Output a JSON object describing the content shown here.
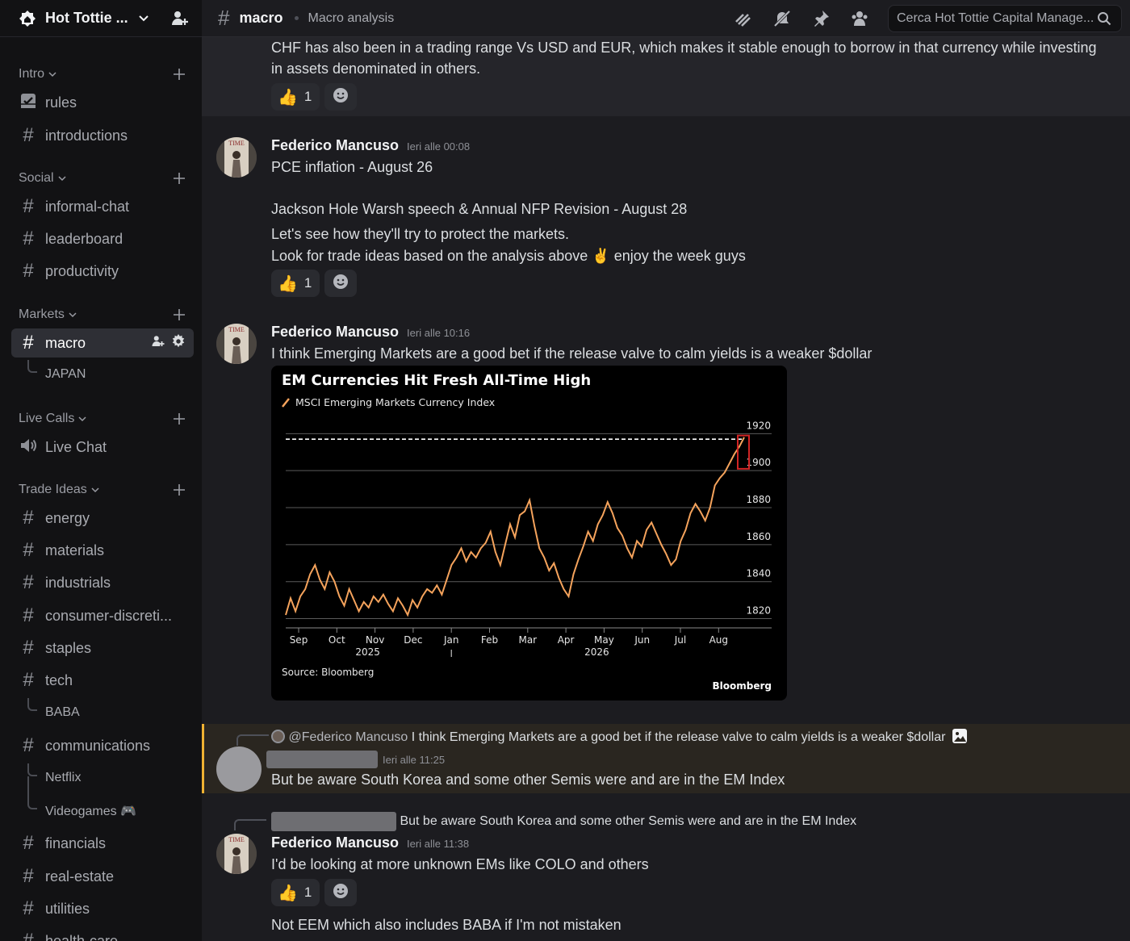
{
  "server": {
    "name": "Hot Tottie ...",
    "icons": {
      "home": "server-home-icon",
      "invite": "invite-people-icon"
    }
  },
  "sidebar": {
    "categories": [
      {
        "label": "Intro"
      },
      {
        "label": "Social"
      },
      {
        "label": "Markets"
      },
      {
        "label": "Live Calls"
      },
      {
        "label": "Trade Ideas"
      }
    ],
    "channels": {
      "rules": "rules",
      "introductions": "introductions",
      "informal_chat": "informal-chat",
      "leaderboard": "leaderboard",
      "productivity": "productivity",
      "macro": "macro",
      "japan": "JAPAN",
      "live_chat": "Live Chat",
      "energy": "energy",
      "materials": "materials",
      "industrials": "industrials",
      "consumer": "consumer-discreti...",
      "staples": "staples",
      "tech": "tech",
      "baba": "BABA",
      "communications": "communications",
      "netflix": "Netflix",
      "videogames": "Videogames 🎮",
      "financials": "financials",
      "real_estate": "real-estate",
      "utilities": "utilities",
      "health_care": "health-care"
    }
  },
  "header": {
    "channel": "macro",
    "topic": "Macro analysis",
    "search_placeholder": "Cerca Hot Tottie Capital Manage..."
  },
  "messages": {
    "m0": {
      "line1": "CHF has also been in a trading range Vs USD and EUR, which makes it stable enough to borrow in that currency while investing",
      "line2": "in assets denominated in others.",
      "reaction": {
        "emoji": "👍",
        "count": "1"
      }
    },
    "m1": {
      "author": "Federico Mancuso",
      "time": "Ieri alle 00:08",
      "line1": "PCE inflation - August 26",
      "line2": "Jackson Hole Warsh speech & Annual NFP Revision - August 28",
      "line3": "Let's see how they'll try to protect the markets.",
      "line4a": "Look for trade ideas based on the analysis above",
      "line4_emoji": "✌️",
      "line4b": "enjoy the week guys",
      "reaction": {
        "emoji": "👍",
        "count": "1"
      }
    },
    "m2": {
      "author": "Federico Mancuso",
      "time": "Ieri alle 10:16",
      "text": "I think Emerging Markets are a good bet if the release valve to calm yields is a weaker $dollar"
    },
    "m3": {
      "reply_author": "@Federico Mancuso",
      "reply_text": "I think Emerging Markets are a good bet if the release valve to calm yields is a weaker $dollar",
      "time": "Ieri alle 11:25",
      "text": "But be aware South Korea and some other Semis were and are  in the EM Index"
    },
    "m4": {
      "reply_text": "But be aware South Korea and some other Semis were and are  in the EM Index",
      "author": "Federico Mancuso",
      "time": "Ieri alle 11:38",
      "text": "I'd be looking at more unknown EMs like COLO and others",
      "reaction": {
        "emoji": "👍",
        "count": "1"
      },
      "text2": "Not EEM which also includes BABA if I'm not mistaken"
    }
  },
  "chart_data": {
    "type": "line",
    "title": "EM Currencies Hit Fresh All-Time High",
    "legend": "MSCI Emerging Markets Currency Index",
    "source": "Source: Bloomberg",
    "brand": "Bloomberg",
    "ylim": [
      1815,
      1928
    ],
    "yticks": [
      1820,
      1840,
      1860,
      1880,
      1900,
      1920
    ],
    "xticks": [
      "Sep",
      "Oct",
      "Nov",
      "Dec",
      "Jan",
      "Feb",
      "Mar",
      "Apr",
      "May",
      "Jun",
      "Jul",
      "Aug"
    ],
    "year_labels": [
      {
        "label": "2025",
        "under": "Nov"
      },
      {
        "label": "2026",
        "under": "May"
      }
    ],
    "reference_line": 1917,
    "line_color": "#f5a35c",
    "grid": true,
    "series": [
      {
        "values": [
          1822,
          1831,
          1824,
          1832,
          1836,
          1844,
          1849,
          1841,
          1836,
          1845,
          1840,
          1832,
          1827,
          1836,
          1830,
          1824,
          1829,
          1826,
          1832,
          1829,
          1833,
          1828,
          1824,
          1831,
          1827,
          1822,
          1830,
          1826,
          1832,
          1836,
          1834,
          1838,
          1833,
          1841,
          1849,
          1853,
          1858,
          1851,
          1856,
          1853,
          1858,
          1861,
          1867,
          1856,
          1849,
          1860,
          1871,
          1864,
          1876,
          1878,
          1884,
          1870,
          1858,
          1853,
          1846,
          1850,
          1842,
          1836,
          1832,
          1844,
          1852,
          1859,
          1867,
          1862,
          1871,
          1876,
          1883,
          1877,
          1869,
          1865,
          1858,
          1853,
          1862,
          1859,
          1868,
          1872,
          1866,
          1860,
          1855,
          1849,
          1852,
          1862,
          1868,
          1877,
          1882,
          1878,
          1873,
          1880,
          1892,
          1896,
          1899,
          1904,
          1909,
          1913,
          1918
        ]
      }
    ]
  },
  "colors": {
    "accent_mention": "#f0b232",
    "reply_bg": "#2a2620"
  }
}
